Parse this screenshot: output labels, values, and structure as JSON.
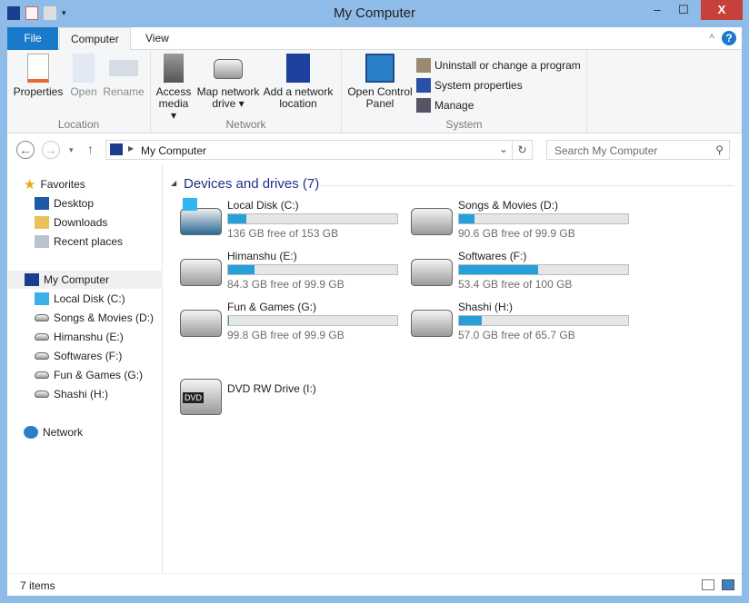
{
  "window": {
    "title": "My Computer",
    "minimize": "–",
    "maximize": "☐",
    "close": "X"
  },
  "ribbon_tabs": [
    "File",
    "Computer",
    "View"
  ],
  "ribbon": {
    "location": {
      "label": "Location",
      "properties": "Properties",
      "open": "Open",
      "rename": "Rename"
    },
    "network": {
      "label": "Network",
      "access_media": "Access media ▾",
      "map_drive": "Map network drive ▾",
      "add_location": "Add a network location"
    },
    "system": {
      "label": "System",
      "control_panel": "Open Control Panel",
      "uninstall": "Uninstall or change a program",
      "sys_props": "System properties",
      "manage": "Manage"
    }
  },
  "address": {
    "path": "My Computer",
    "search_placeholder": "Search My Computer"
  },
  "nav": {
    "favorites": "Favorites",
    "desktop": "Desktop",
    "downloads": "Downloads",
    "recent": "Recent places",
    "computer": "My Computer",
    "drives": [
      "Local Disk (C:)",
      "Songs & Movies (D:)",
      "Himanshu (E:)",
      "Softwares (F:)",
      "Fun & Games (G:)",
      "Shashi (H:)"
    ],
    "network": "Network"
  },
  "section": "Devices and drives (7)",
  "drives": [
    {
      "name": "Local Disk (C:)",
      "free": "136 GB free of 153 GB",
      "used_fraction": 0.11
    },
    {
      "name": "Songs & Movies (D:)",
      "free": "90.6 GB free of 99.9 GB",
      "used_fraction": 0.093
    },
    {
      "name": "Himanshu (E:)",
      "free": "84.3 GB free of 99.9 GB",
      "used_fraction": 0.156
    },
    {
      "name": "Softwares (F:)",
      "free": "53.4 GB free of 100 GB",
      "used_fraction": 0.466
    },
    {
      "name": "Fun & Games (G:)",
      "free": "99.8 GB free of 99.9 GB",
      "used_fraction": 0.001
    },
    {
      "name": "Shashi (H:)",
      "free": "57.0 GB free of 65.7 GB",
      "used_fraction": 0.132
    }
  ],
  "dvd": {
    "name": "DVD RW Drive (I:)",
    "badge": "DVD"
  },
  "status": "7 items",
  "accent": "#26a0da"
}
